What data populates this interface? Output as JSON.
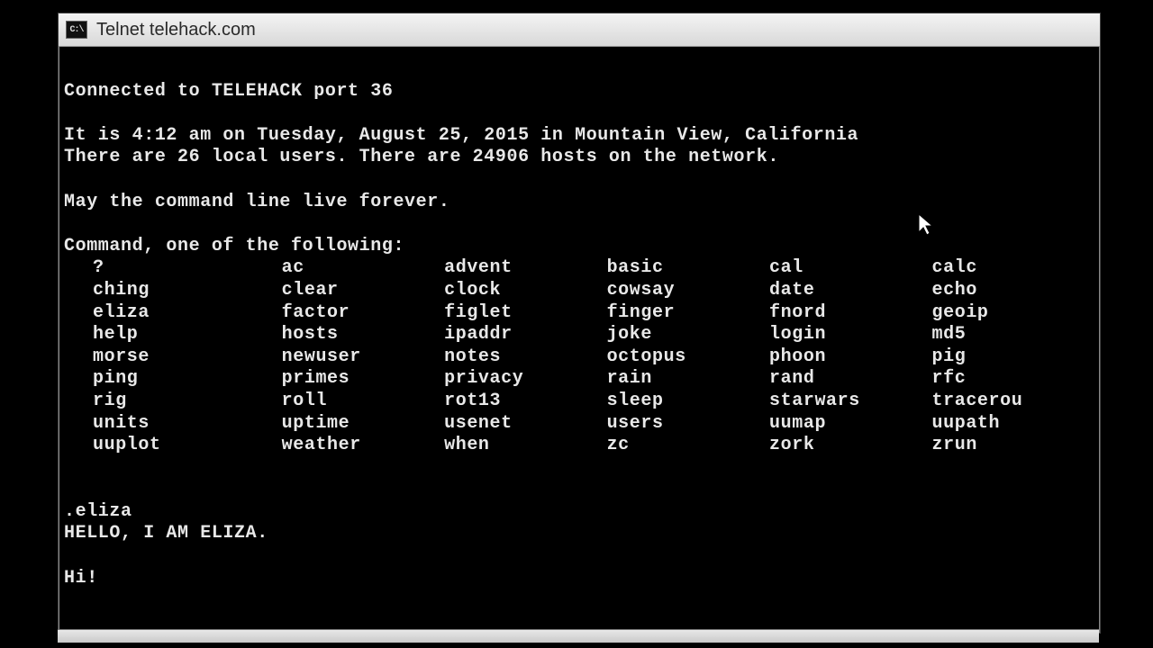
{
  "window": {
    "title": "Telnet telehack.com",
    "icon_label": "C:\\"
  },
  "terminal": {
    "connected_line": "Connected to TELEHACK port 36",
    "datetime_line": "It is 4:12 am on Tuesday, August 25, 2015 in Mountain View, California",
    "users_line": "There are 26 local users. There are 24906 hosts on the network.",
    "motto_line": "May the command line live forever.",
    "command_prompt_line": "Command, one of the following:",
    "commands": [
      [
        "?",
        "ac",
        "advent",
        "basic",
        "cal",
        "calc"
      ],
      [
        "ching",
        "clear",
        "clock",
        "cowsay",
        "date",
        "echo"
      ],
      [
        "eliza",
        "factor",
        "figlet",
        "finger",
        "fnord",
        "geoip"
      ],
      [
        "help",
        "hosts",
        "ipaddr",
        "joke",
        "login",
        "md5"
      ],
      [
        "morse",
        "newuser",
        "notes",
        "octopus",
        "phoon",
        "pig"
      ],
      [
        "ping",
        "primes",
        "privacy",
        "rain",
        "rand",
        "rfc"
      ],
      [
        "rig",
        "roll",
        "rot13",
        "sleep",
        "starwars",
        "tracerou"
      ],
      [
        "units",
        "uptime",
        "usenet",
        "users",
        "uumap",
        "uupath"
      ],
      [
        "uuplot",
        "weather",
        "when",
        "zc",
        "zork",
        "zrun"
      ]
    ],
    "user_command": ".eliza",
    "eliza_greeting": "HELLO, I AM ELIZA.",
    "user_input": "Hi!"
  }
}
